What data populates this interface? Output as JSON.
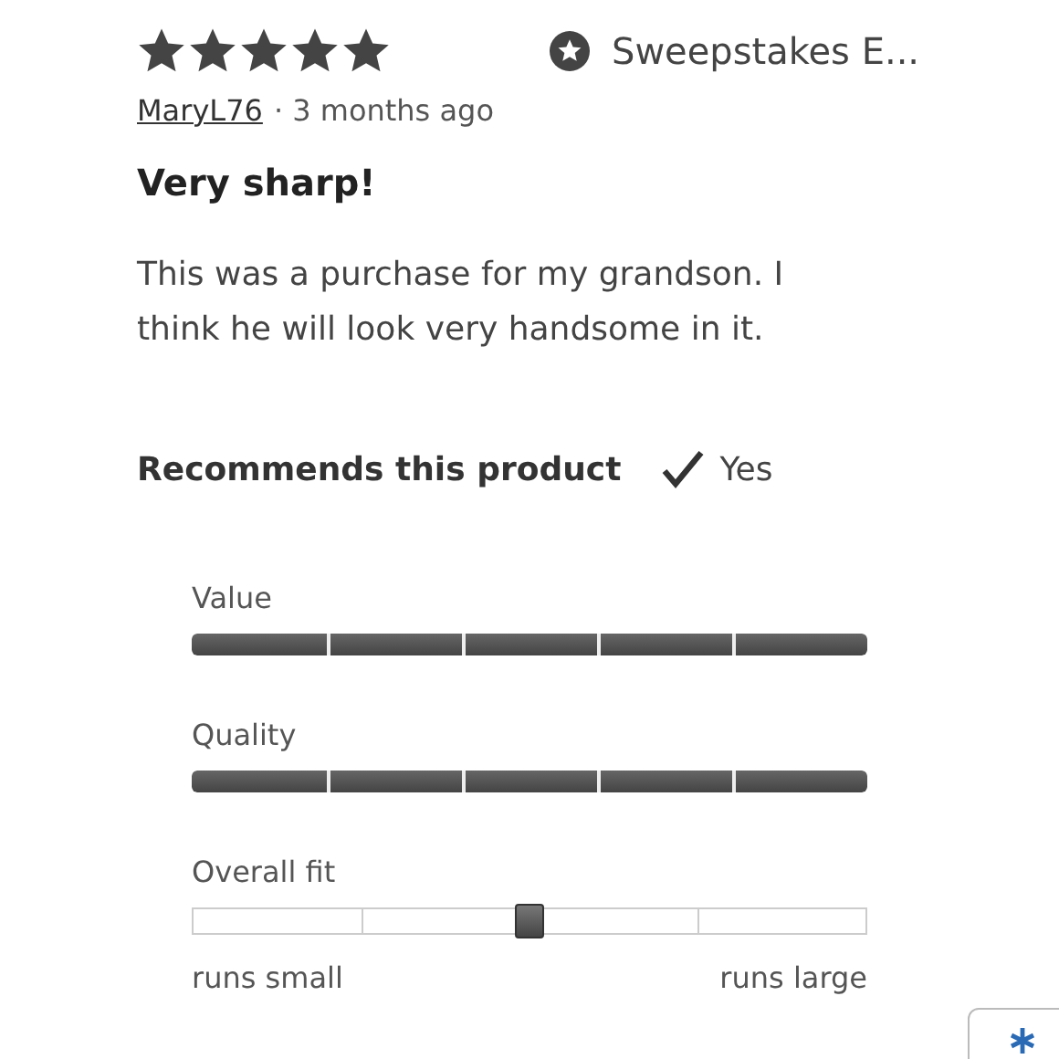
{
  "review": {
    "stars": 5,
    "badge": "Sweepstakes E...",
    "author": "MaryL76",
    "time": "· 3 months ago",
    "title": "Very sharp!",
    "body": "This was a purchase for my grandson. I think he will look very handsome in it.",
    "recommend": {
      "label": "Recommends this product",
      "answer": "Yes",
      "checked": true
    }
  },
  "ratings": [
    {
      "kind": "bar",
      "label": "Value",
      "level": 1
    },
    {
      "kind": "bar",
      "label": "Quality",
      "level": 1
    },
    {
      "kind": "slider",
      "label": "Overall fit",
      "level": 0.5,
      "min_label": "runs small",
      "max_label": "runs large"
    }
  ]
}
